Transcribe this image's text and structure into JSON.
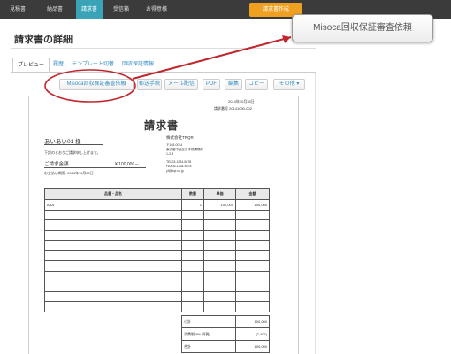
{
  "nav": {
    "tabs": [
      "見積書",
      "納品書",
      "請求書",
      "受信箱",
      "お得意様"
    ],
    "active_tab": "請求書",
    "cta_label": "請求書作成",
    "bg_color": "#3b3b3b",
    "active_color": "#3aa3b8",
    "cta_color": "#f0a020"
  },
  "page": {
    "title": "請求書の詳細"
  },
  "subtabs": [
    "プレビュー",
    "履歴",
    "テンプレート切替",
    "回収保証情報"
  ],
  "toolbar": {
    "misoca": "Misoca回収保証審査依頼",
    "send": "郵送手続",
    "mail": "メール配信",
    "pdf": "PDF",
    "edit": "編集",
    "copy": "コピー",
    "other": "その他 ▾"
  },
  "callout": {
    "label": "Misoca回収保証審査依頼"
  },
  "highlight_color": "#c0272d",
  "invoice": {
    "date": "2014年10月30日",
    "number": "請求番号 20141030-002",
    "title": "請求書",
    "client": "あいあい01 様",
    "note": "下記のとおりご請求申し上げます。",
    "amount_label": "ご請求金額",
    "amount": "¥ 100,000－",
    "due": "お支払い期限: 2014年11月30日",
    "company": {
      "name": "株式会社TRQR",
      "postal": "〒103-0014",
      "address1": "東京都中央区日本橋蠣殻町",
      "address2": "1-2-3",
      "tel": "TEL03-1234-5678",
      "fax": "FAX03-1234-5678",
      "email": "yf@trqr.co.jp"
    },
    "columns": [
      "品番・品名",
      "数量",
      "単価",
      "金額"
    ],
    "items": [
      {
        "name": "AAA",
        "qty": "1",
        "price": "100,000",
        "total": "100,000"
      }
    ],
    "summary": [
      {
        "label": "小計",
        "value": "100,000"
      },
      {
        "label": "消費税(8% 円税)",
        "value": "(7,407)"
      },
      {
        "label": "合計",
        "value": "100,000"
      }
    ]
  }
}
